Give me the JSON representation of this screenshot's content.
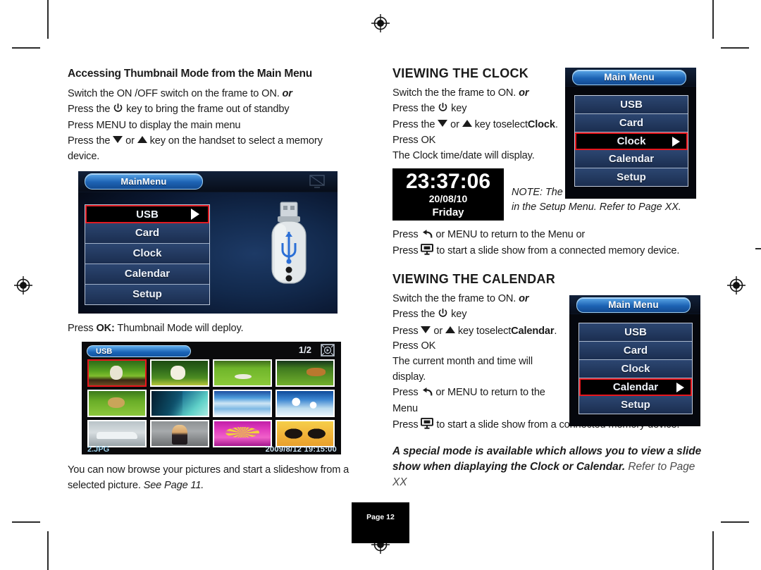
{
  "document": {
    "page_label": "Page 12"
  },
  "left_column": {
    "heading": "Accessing Thumbnail Mode from the Main Menu",
    "steps": {
      "line1_a": "Switch the ON /OFF switch on the frame to ON.",
      "line1_em": "or",
      "line2_a": "Press  the",
      "line2_b": "key to bring the frame out of standby",
      "line3": "Press MENU to display the main menu",
      "line4_a": "Press the",
      "line4_b": "or",
      "line4_c": "key on the handset to select a memory device."
    },
    "after_menu": {
      "a": "Press ",
      "b": "OK:",
      "c": " Thumbnail Mode will deploy."
    },
    "closing": {
      "a": "You can now browse your pictures and start a slideshow from a selected picture. ",
      "b": "See Page 11."
    }
  },
  "main_menu_screen": {
    "title": "MainMenu",
    "items": [
      {
        "label": "USB",
        "selected": true,
        "arrow": true
      },
      {
        "label": "Card",
        "selected": false,
        "arrow": false
      },
      {
        "label": "Clock",
        "selected": false,
        "arrow": false
      },
      {
        "label": "Calendar",
        "selected": false,
        "arrow": false
      },
      {
        "label": "Setup",
        "selected": false,
        "arrow": false
      }
    ],
    "artwork_icon": "usb-flash-drive-icon",
    "corner_icon": "tv-slideshow-icon"
  },
  "thumbnail_screen": {
    "source_label": "USB",
    "page_indicator": "1/2",
    "badge_icon": "slideshow-badge-icon",
    "filename": "2.JPG",
    "timestamp": "2009/8/12  19:15:00",
    "thumbs": [
      {
        "name": "white-dog-in-grass",
        "selected": true
      },
      {
        "name": "white-dog-with-flowers",
        "selected": false
      },
      {
        "name": "dog-lying-on-lawn",
        "selected": false
      },
      {
        "name": "two-dogs-on-grass",
        "selected": false
      },
      {
        "name": "puppy-on-grass",
        "selected": false
      },
      {
        "name": "palm-leaf-over-sea",
        "selected": false
      },
      {
        "name": "snowy-mountain-slope",
        "selected": false
      },
      {
        "name": "frosted-trees-blue-sky",
        "selected": false
      },
      {
        "name": "silver-sports-car",
        "selected": false
      },
      {
        "name": "woman-portrait",
        "selected": false
      },
      {
        "name": "pink-parasol",
        "selected": false
      },
      {
        "name": "yellow-butterfly",
        "selected": false
      }
    ]
  },
  "clock_section": {
    "heading": "VIEWING THE CLOCK",
    "steps": {
      "line1_a": "Switch the the frame to ON.",
      "line1_em": "or",
      "line2_a": "Press  the",
      "line2_b": "key",
      "line3_a": "Press the",
      "line3_b": "or",
      "line3_c": "key toselect",
      "line3_d": "Clock",
      "line3_e": ".",
      "line4": "Press OK",
      "line5": "The Clock time/date will display."
    },
    "note": "NOTE: The Time and Date should  be set in the Setup Menu. Refer to Page XX.",
    "outro": {
      "line1_a": "Press",
      "line1_b": "or MENU to return to the Menu or",
      "line2_a": "Press",
      "line2_b": "to start a slide show from a connected memory device."
    }
  },
  "clock_widget": {
    "time": "23:37:06",
    "date": "20/08/10",
    "day": "Friday"
  },
  "clock_menu_screen": {
    "title": "Main Menu",
    "items": [
      {
        "label": "USB",
        "selected": false,
        "arrow": false
      },
      {
        "label": "Card",
        "selected": false,
        "arrow": false
      },
      {
        "label": "Clock",
        "selected": true,
        "arrow": true
      },
      {
        "label": "Calendar",
        "selected": false,
        "arrow": false
      },
      {
        "label": "Setup",
        "selected": false,
        "arrow": false
      }
    ]
  },
  "calendar_section": {
    "heading": "VIEWING THE CALENDAR",
    "steps": {
      "line1_a": "Switch the the frame to ON.",
      "line1_em": "or",
      "line2_a": "Press  the",
      "line2_b": "key",
      "line3_a": "Press",
      "line3_b": "or",
      "line3_c": "key toselect",
      "line3_d": "Calendar",
      "line3_e": ".",
      "line4": "Press OK",
      "line5": "The current month and time will display.",
      "line6_a": "Press",
      "line6_b": "or MENU to return to the Menu",
      "line7_a": "Press",
      "line7_b": "to start a slide show from a connected memory device."
    },
    "special": {
      "bold": "A special mode is available which allows you to view a slide show when diaplaying the Clock or Calendar.",
      "reg": " Refer to Page XX"
    }
  },
  "calendar_menu_screen": {
    "title": "Main Menu",
    "items": [
      {
        "label": "USB",
        "selected": false,
        "arrow": false
      },
      {
        "label": "Card",
        "selected": false,
        "arrow": false
      },
      {
        "label": "Clock",
        "selected": false,
        "arrow": false
      },
      {
        "label": "Calendar",
        "selected": true,
        "arrow": true
      },
      {
        "label": "Setup",
        "selected": false,
        "arrow": false
      }
    ]
  },
  "icons": {
    "power": "power-standby-icon",
    "back": "back-arrow-icon",
    "slideshow": "slideshow-screen-icon",
    "down_key": "down-arrow-key-icon",
    "up_key": "up-arrow-key-icon",
    "registration": "registration-mark-icon",
    "crop": "crop-mark-icon"
  },
  "colors": {
    "selection_red": "#e8161d",
    "menu_blue": "#2c4671",
    "title_pill_blue": "#1d63b4",
    "screen_black": "#05070d"
  }
}
